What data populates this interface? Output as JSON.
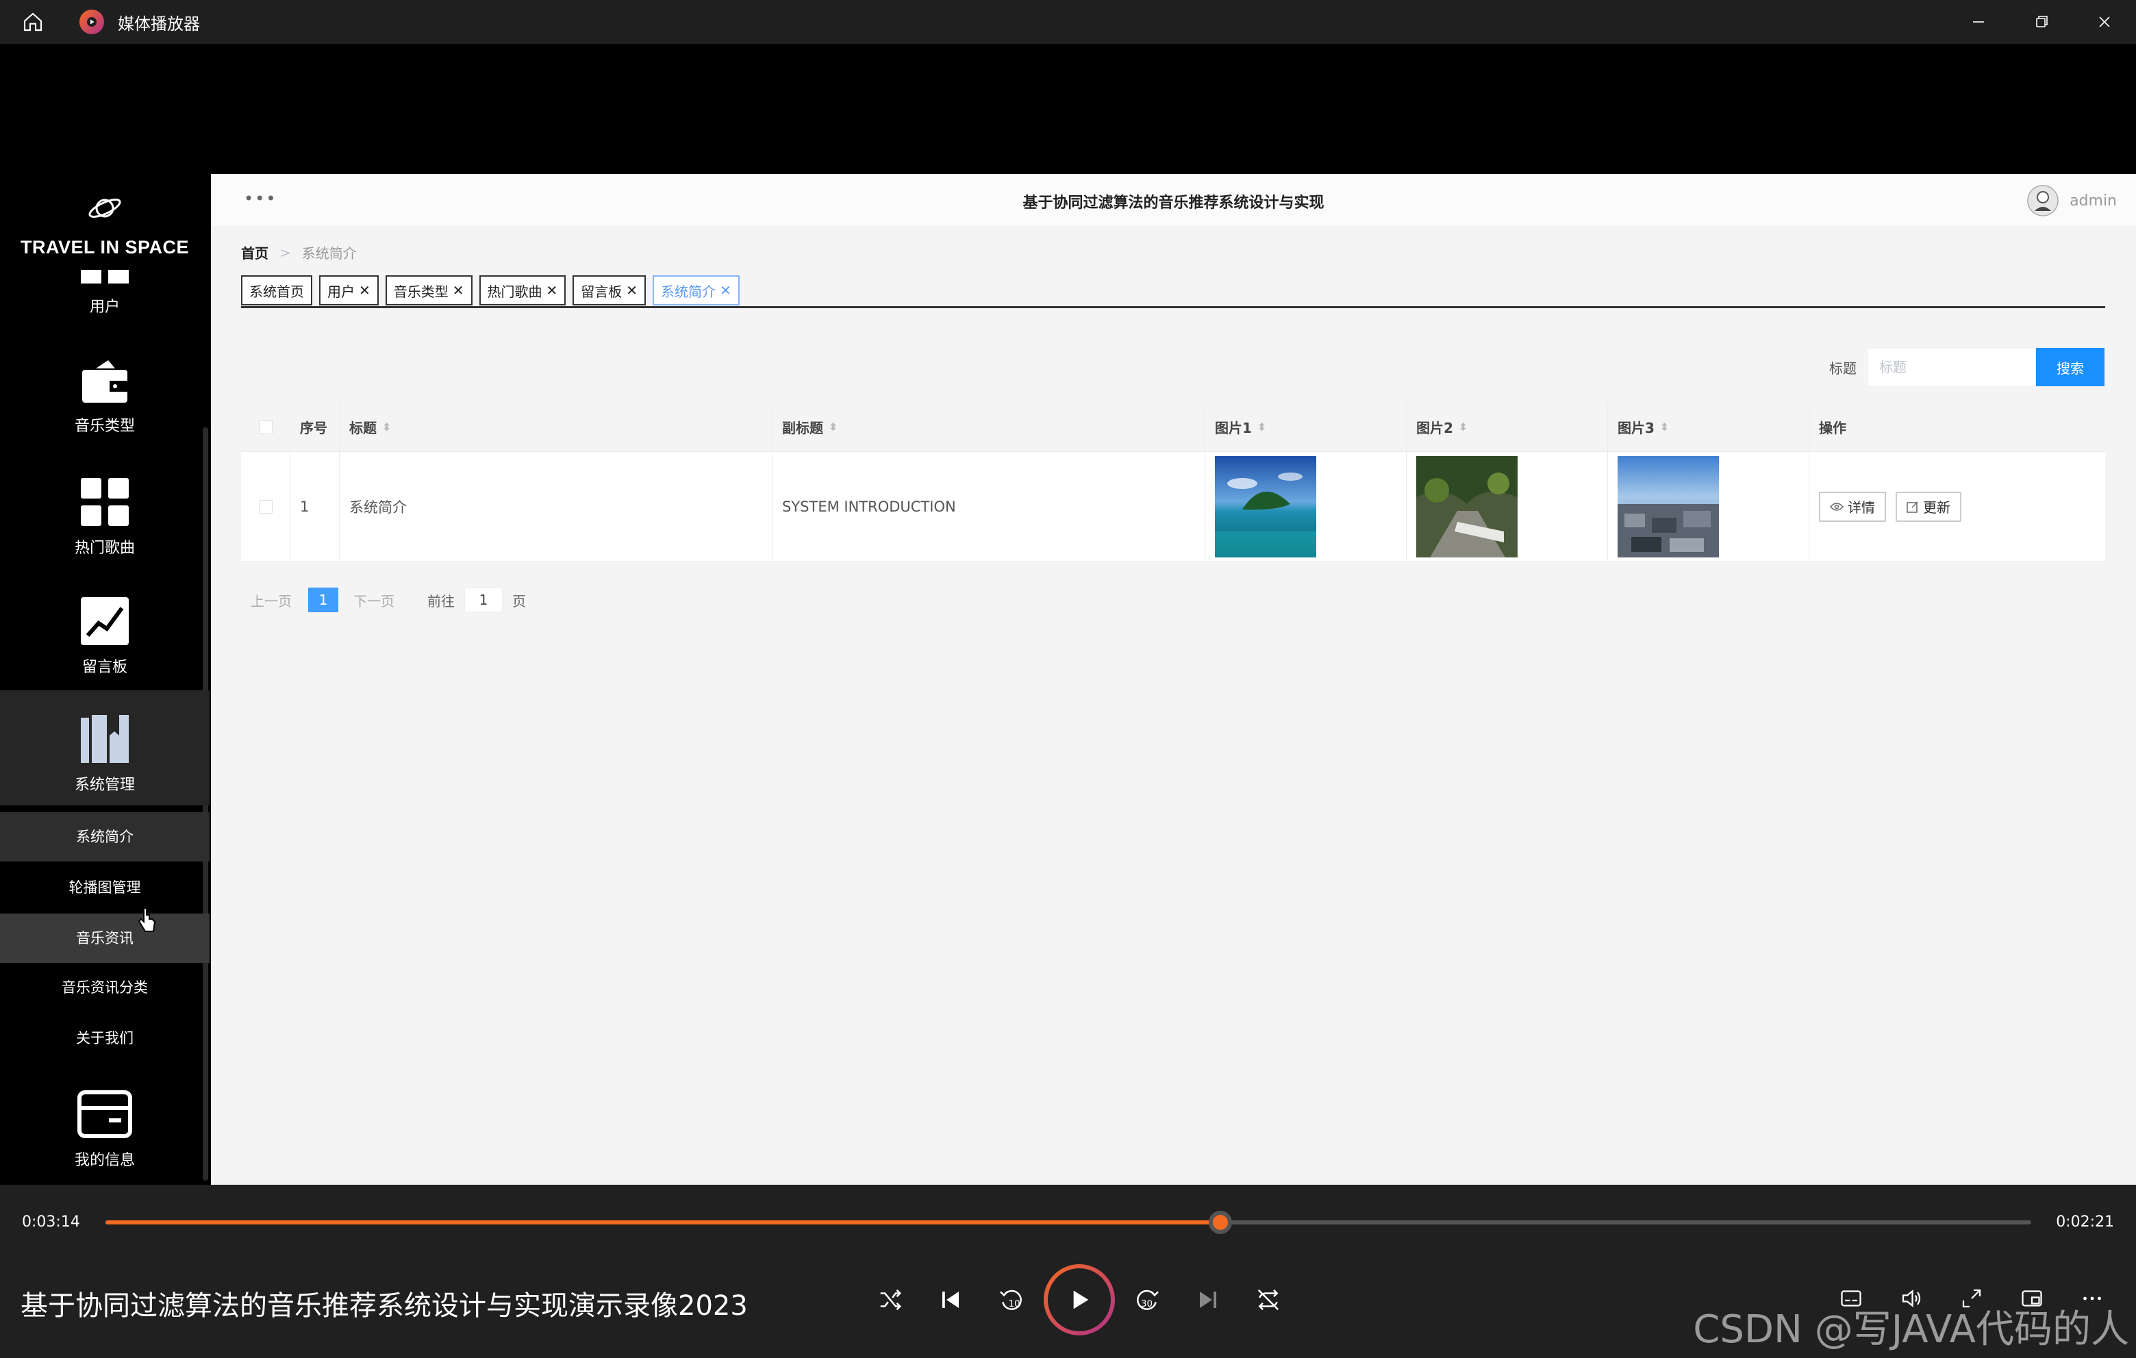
{
  "player": {
    "app_title": "媒体播放器",
    "current_time": "0:03:14",
    "total_time": "0:02:21",
    "progress": 0.579,
    "video_title": "基于协同过滤算法的音乐推荐系统设计与实现演示录像2023",
    "watermark": "CSDN @写JAVA代码的人",
    "accent_color": "#f36b21"
  },
  "sidebar": {
    "logo_text": "TRAVEL IN SPACE",
    "items": [
      {
        "label": "用户",
        "icon": "user-grid-icon"
      },
      {
        "label": "音乐类型",
        "icon": "wallet-icon"
      },
      {
        "label": "热门歌曲",
        "icon": "grid-icon"
      },
      {
        "label": "留言板",
        "icon": "chart-icon"
      },
      {
        "label": "系统管理",
        "icon": "book-icon"
      },
      {
        "label": "我的信息",
        "icon": "card-icon"
      }
    ],
    "sub_items": [
      {
        "label": "系统简介"
      },
      {
        "label": "轮播图管理"
      },
      {
        "label": "音乐资讯"
      },
      {
        "label": "音乐资讯分类"
      },
      {
        "label": "关于我们"
      }
    ]
  },
  "header": {
    "title": "基于协同过滤算法的音乐推荐系统设计与实现",
    "username": "admin"
  },
  "breadcrumb": {
    "home": "首页",
    "current": "系统简介"
  },
  "tabs": [
    {
      "label": "系统首页"
    },
    {
      "label": "用户"
    },
    {
      "label": "音乐类型"
    },
    {
      "label": "热门歌曲"
    },
    {
      "label": "留言板"
    },
    {
      "label": "系统简介"
    }
  ],
  "search": {
    "label": "标题",
    "placeholder": "标题",
    "button": "搜索",
    "button_color": "#1890ff"
  },
  "table": {
    "columns": [
      "序号",
      "标题",
      "副标题",
      "图片1",
      "图片2",
      "图片3",
      "操作"
    ],
    "rows": [
      {
        "no": "1",
        "title": "系统简介",
        "subtitle": "SYSTEM INTRODUCTION",
        "detail": "详情",
        "update": "更新"
      }
    ]
  },
  "pager": {
    "prev": "上一页",
    "page": "1",
    "next": "下一页",
    "goto": "前往",
    "goto_value": "1",
    "unit": "页"
  }
}
